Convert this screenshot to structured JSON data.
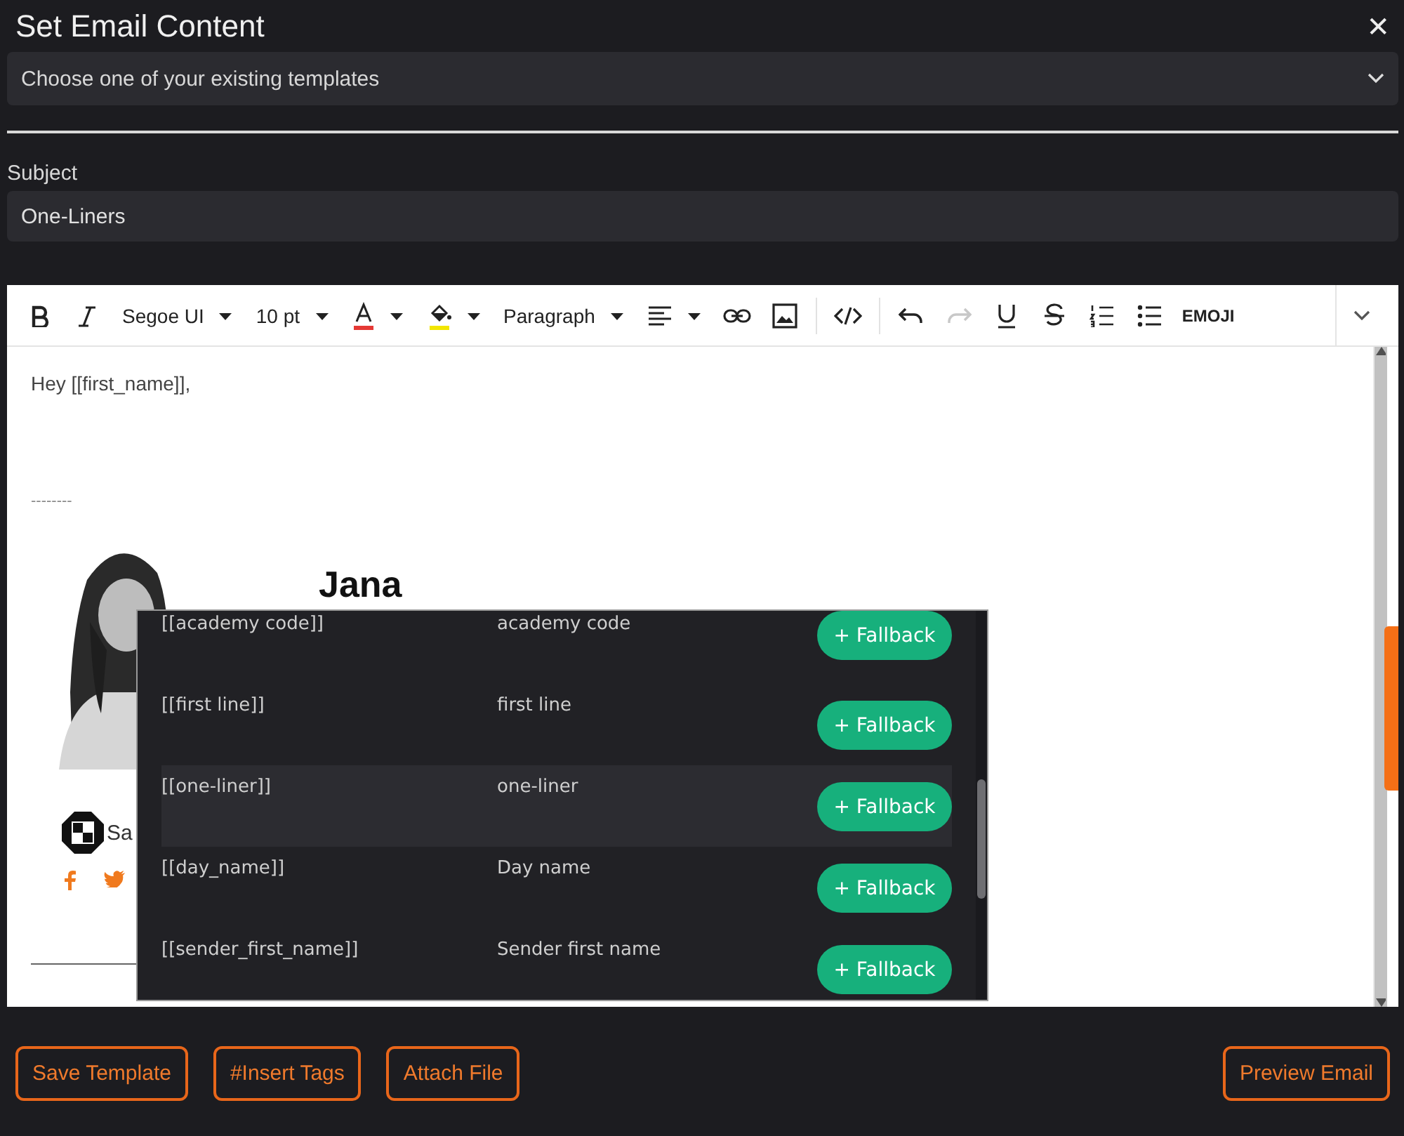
{
  "dialog": {
    "title": "Set Email Content",
    "close": "✕"
  },
  "template_select": {
    "placeholder": "Choose one of your existing templates"
  },
  "subject": {
    "label": "Subject",
    "value": "One-Liners"
  },
  "toolbar": {
    "font": "Segoe UI",
    "size": "10 pt",
    "block": "Paragraph",
    "emoji": "EMOJI",
    "redo_disabled": true
  },
  "body": {
    "greeting": "Hey [[first_name]],",
    "separator": "--------",
    "signature_name": "Jana",
    "company": "Sa"
  },
  "tag_popup": {
    "rows": [
      {
        "tag": "[[academy code]]",
        "label": "academy code",
        "button": "+ Fallback",
        "highlighted": false
      },
      {
        "tag": "[[first line]]",
        "label": "first line",
        "button": "+ Fallback",
        "highlighted": false
      },
      {
        "tag": "[[one-liner]]",
        "label": "one-liner",
        "button": "+ Fallback",
        "highlighted": true
      },
      {
        "tag": "[[day_name]]",
        "label": "Day name",
        "button": "+ Fallback",
        "highlighted": false
      },
      {
        "tag": "[[sender_first_name]]",
        "label": "Sender first name",
        "button": "+ Fallback",
        "highlighted": false
      }
    ]
  },
  "footer": {
    "left_buttons": [
      "Save Template",
      "#Insert Tags",
      "Attach File"
    ],
    "right_button": "Preview Email"
  }
}
